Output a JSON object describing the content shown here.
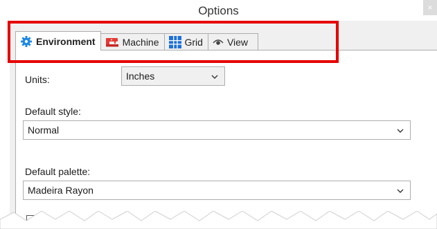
{
  "window": {
    "title": "Options",
    "close_label": "×"
  },
  "tabs": [
    {
      "label": "Environment",
      "icon": "gear-icon",
      "active": true
    },
    {
      "label": "Machine",
      "icon": "sewing-machine-icon",
      "active": false
    },
    {
      "label": "Grid",
      "icon": "grid-icon",
      "active": false
    },
    {
      "label": "View",
      "icon": "eye-icon",
      "active": false
    }
  ],
  "units": {
    "label": "Units:",
    "value": "Inches"
  },
  "default_style": {
    "label": "Default style:",
    "value": "Normal"
  },
  "default_palette": {
    "label": "Default palette:",
    "value": "Madeira Rayon"
  },
  "checkbox": {
    "checked": true
  },
  "colors": {
    "highlight": "#e60000",
    "gear": "#1e88e5",
    "machine": "#e53935",
    "grid": "#1e6fd9"
  }
}
